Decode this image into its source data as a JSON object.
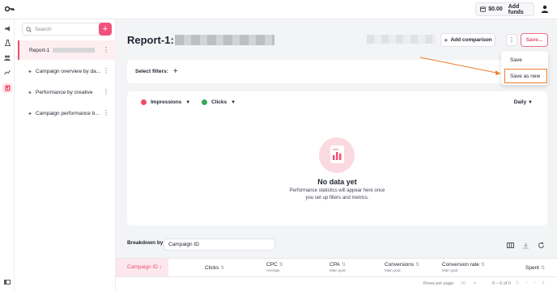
{
  "topbar": {
    "balance": "$0.00",
    "add_funds": "Add funds"
  },
  "sidebar": {
    "search_placeholder": "Search",
    "items": [
      {
        "label": "Report-1"
      },
      {
        "label": "Campaign overview by da..."
      },
      {
        "label": "Performance by creative"
      },
      {
        "label": "Campaign performance b..."
      }
    ]
  },
  "header": {
    "title": "Report-1:",
    "add_comparison": "Add comparison",
    "save_button": "Save..."
  },
  "filters": {
    "label": "Select filters:"
  },
  "chart": {
    "metric1": "Impressions",
    "metric2": "Clicks",
    "granularity": "Daily",
    "empty_title": "No data yet",
    "empty_subtitle": "Performance statistics will appear here once you set up filters and metrics.",
    "colors": {
      "impressions": "#ef4b6b",
      "clicks": "#3aa757"
    }
  },
  "breakdown": {
    "label": "Breakdown by:",
    "value": "Campaign ID"
  },
  "table": {
    "columns": [
      {
        "label": "Campaign ID",
        "sub": ""
      },
      {
        "label": "Clicks",
        "sub": ""
      },
      {
        "label": "CPC",
        "sub": "Average"
      },
      {
        "label": "CPA",
        "sub": "Main goal"
      },
      {
        "label": "Conversions",
        "sub": "Main goal"
      },
      {
        "label": "Conversion rate",
        "sub": "Main goal"
      },
      {
        "label": "Spent",
        "sub": ""
      }
    ]
  },
  "pager": {
    "rows_label": "Rows per page:",
    "rows_value": "20",
    "range": "0 – 0 of 0"
  },
  "menu": {
    "save": "Save",
    "save_as_new": "Save as new"
  }
}
